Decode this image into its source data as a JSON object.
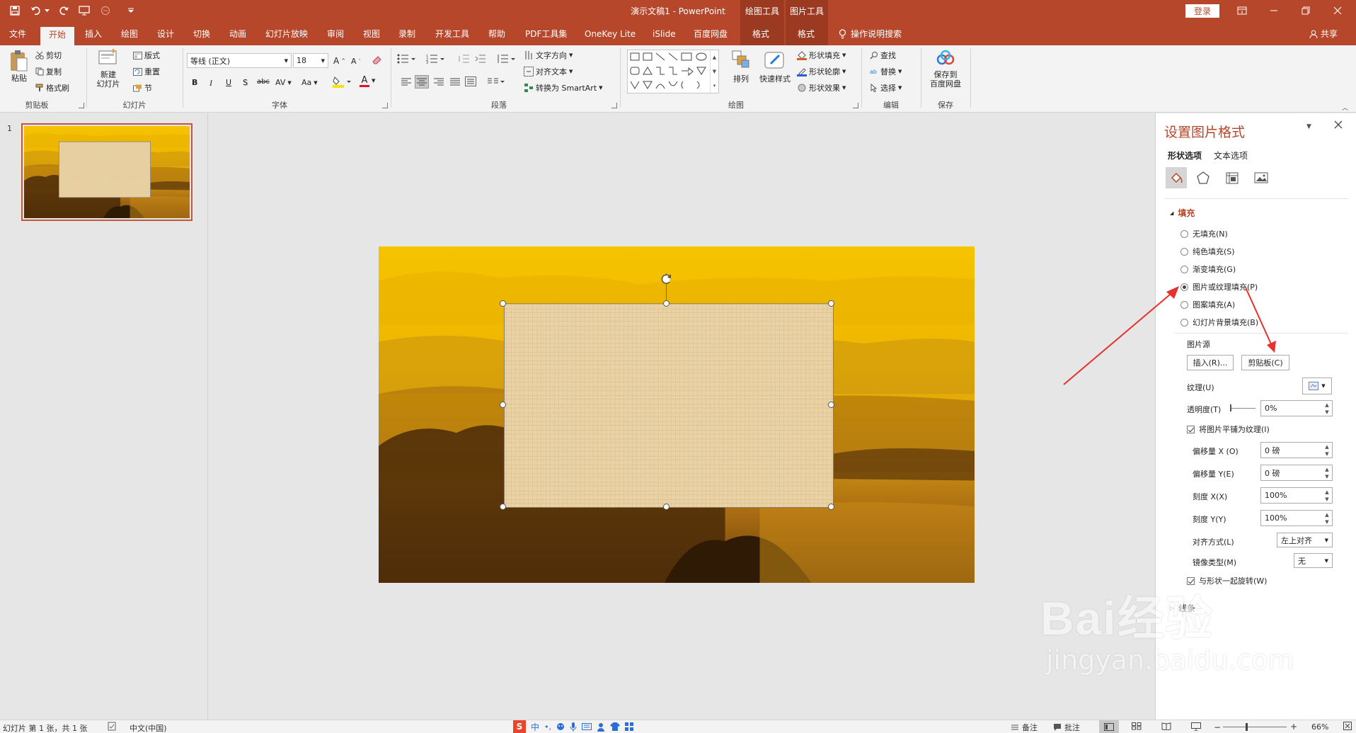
{
  "window": {
    "title": "演示文稿1  -  PowerPoint",
    "login": "登录"
  },
  "context_tabs": {
    "drawing_tools": "绘图工具",
    "picture_tools": "图片工具"
  },
  "tabs": [
    "文件",
    "开始",
    "插入",
    "绘图",
    "设计",
    "切换",
    "动画",
    "幻灯片放映",
    "审阅",
    "视图",
    "录制",
    "开发工具",
    "帮助",
    "PDF工具集",
    "OneKey Lite",
    "iSlide",
    "百度网盘"
  ],
  "context_format_tabs": [
    "格式",
    "格式"
  ],
  "tell_me": "操作说明搜索",
  "share": "共享",
  "ribbon": {
    "clipboard": {
      "label": "剪贴板",
      "paste": "粘贴",
      "cut": "剪切",
      "copy": "复制",
      "format_painter": "格式刷"
    },
    "slides": {
      "label": "幻灯片",
      "new_slide": "新建\n幻灯片",
      "layout": "版式",
      "reset": "重置",
      "section": "节"
    },
    "font": {
      "label": "字体",
      "font_name": "等线 (正文)",
      "font_size": "18",
      "bold": "B",
      "italic": "I",
      "underline": "U",
      "shadow": "S",
      "strike": "abc",
      "spacing": "AV",
      "case": "Aa",
      "font_color_glyph": "A"
    },
    "paragraph": {
      "label": "段落",
      "text_direction": "文字方向",
      "align_text": "对齐文本",
      "smartart": "转换为 SmartArt"
    },
    "drawing": {
      "label": "绘图",
      "arrange": "排列",
      "quick_styles": "快速样式",
      "shape_fill": "形状填充",
      "shape_outline": "形状轮廓",
      "shape_effects": "形状效果"
    },
    "editing": {
      "label": "编辑",
      "find": "查找",
      "replace": "替换",
      "select": "选择"
    },
    "save": {
      "label": "保存",
      "save_to_baidu": "保存到\n百度网盘"
    }
  },
  "thumbnails": [
    {
      "number": "1"
    }
  ],
  "format_pane": {
    "title": "设置图片格式",
    "tabs": [
      "形状选项",
      "文本选项"
    ],
    "fill_section": "填充",
    "fill_options": [
      {
        "label": "无填充(N)",
        "selected": false
      },
      {
        "label": "纯色填充(S)",
        "selected": false
      },
      {
        "label": "渐变填充(G)",
        "selected": false
      },
      {
        "label": "图片或纹理填充(P)",
        "selected": true
      },
      {
        "label": "图案填充(A)",
        "selected": false
      },
      {
        "label": "幻灯片背景填充(B)",
        "selected": false
      }
    ],
    "picture_source": "图片源",
    "insert_btn": "插入(R)...",
    "clipboard_btn": "剪贴板(C)",
    "texture_label": "纹理(U)",
    "transparency_label": "透明度(T)",
    "transparency_value": "0%",
    "tile_label": "将图片平铺为纹理(I)",
    "tile_checked": true,
    "offset_x_label": "偏移量 X (O)",
    "offset_x_value": "0 磅",
    "offset_y_label": "偏移量 Y(E)",
    "offset_y_value": "0 磅",
    "scale_x_label": "刻度 X(X)",
    "scale_x_value": "100%",
    "scale_y_label": "刻度 Y(Y)",
    "scale_y_value": "100%",
    "alignment_label": "对齐方式(L)",
    "alignment_value": "左上对齐",
    "mirror_label": "镜像类型(M)",
    "mirror_value": "无",
    "rotate_label": "与形状一起旋转(W)",
    "rotate_checked": true,
    "line_section": "线条"
  },
  "statusbar": {
    "slide_info": "幻灯片 第 1 张，共 1 张",
    "language": "中文(中国)",
    "notes": "备注",
    "comments": "批注",
    "zoom": "66%",
    "ime": "中"
  },
  "watermark": {
    "text": "Bai经验",
    "url": "jingyan.baidu.com"
  },
  "colors": {
    "accent": "#b7472a",
    "annotation": "#e8312e"
  }
}
